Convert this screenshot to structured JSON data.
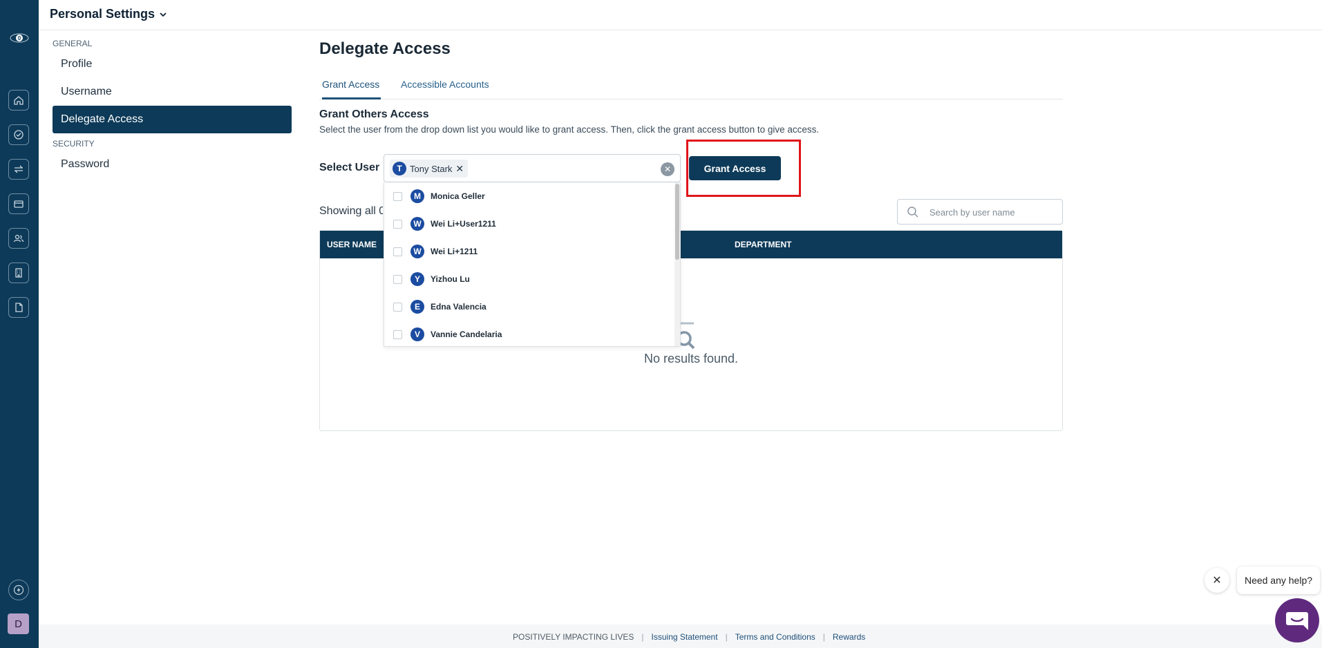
{
  "header": {
    "title": "Personal Settings"
  },
  "rail": {
    "logo_count": "0",
    "items": [
      "home-icon",
      "check-circle-icon",
      "transfer-icon",
      "card-icon",
      "users-icon",
      "building-icon",
      "document-icon"
    ],
    "bottom_icon": "bolt-icon",
    "avatar_initial": "D"
  },
  "nav": {
    "general_label": "GENERAL",
    "general_items": [
      "Profile",
      "Username",
      "Delegate Access"
    ],
    "security_label": "SECURITY",
    "security_items": [
      "Password"
    ],
    "active": "Delegate Access"
  },
  "page": {
    "title": "Delegate Access",
    "tabs": [
      "Grant Access",
      "Accessible Accounts"
    ],
    "section_title": "Grant Others Access",
    "section_desc": "Select the user from the drop down list you would like to grant access. Then, click the grant access button to give access.",
    "select_label": "Select User",
    "selected_chip": {
      "initial": "T",
      "name": "Tony Stark"
    },
    "grant_button": "Grant Access",
    "showing_text": "Showing all 0 users",
    "search_placeholder": "Search by user name",
    "table_headers": [
      "USER NAME",
      "DEPARTMENT"
    ],
    "empty_text": "No results found."
  },
  "dropdown": {
    "options": [
      {
        "initial": "M",
        "name": "Monica Geller"
      },
      {
        "initial": "W",
        "name": "Wei Li+User1211"
      },
      {
        "initial": "W",
        "name": "Wei Li+1211"
      },
      {
        "initial": "Y",
        "name": "Yizhou Lu"
      },
      {
        "initial": "E",
        "name": "Edna Valencia"
      },
      {
        "initial": "V",
        "name": "Vannie Candelaria"
      }
    ]
  },
  "footer": {
    "tagline": "POSITIVELY IMPACTING LIVES",
    "links": [
      "Issuing Statement",
      "Terms and Conditions",
      "Rewards"
    ]
  },
  "help": {
    "bubble_text": "Need any help?"
  },
  "colors": {
    "primary": "#0d3a58",
    "highlight": "#e0151a",
    "avatar_blue": "#1b4ca1",
    "help_purple": "#5f2a7e"
  }
}
